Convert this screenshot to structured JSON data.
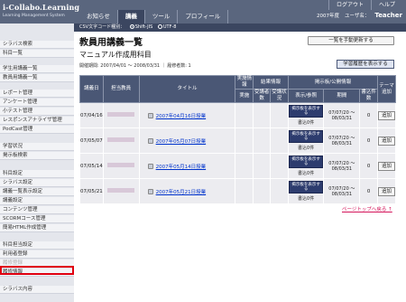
{
  "logo": {
    "title": "i-Collabo.Learning",
    "subtitle": "Learning Management System"
  },
  "header": {
    "links": [
      "ログアウト",
      "ヘルプ"
    ],
    "tabs": [
      "お知らせ",
      "講義",
      "ツール",
      "プロフィール"
    ],
    "active_tab": "講義",
    "year": "2007年度",
    "user_label": "ユーザ名：",
    "role": "Teacher"
  },
  "charset": {
    "label": "CSV文字コード種別",
    "options": [
      "Shift-JIS",
      "UTF-8"
    ],
    "selected": "Shift-JIS"
  },
  "sidebar": {
    "items": [
      {
        "label": "シラバス検索",
        "gray": false
      },
      {
        "label": "科目一覧",
        "gray": false
      },
      {
        "label": "学生用講義一覧",
        "gray": false
      },
      {
        "label": "教員用講義一覧",
        "gray": false
      },
      {
        "label": "レポート管理",
        "gray": false
      },
      {
        "label": "アンケート管理",
        "gray": false
      },
      {
        "label": "小テスト管理",
        "gray": false
      },
      {
        "label": "レスポンスアナライザ管理",
        "gray": false
      },
      {
        "label": "PodCast管理",
        "gray": false
      },
      {
        "label": "学習状況",
        "gray": false
      },
      {
        "label": "掲示板検索",
        "gray": false
      },
      {
        "label": "科目設定",
        "gray": false
      },
      {
        "label": "シラバス設定",
        "gray": false
      },
      {
        "label": "講義一覧表示設定",
        "gray": false
      },
      {
        "label": "講義設定",
        "gray": false
      },
      {
        "label": "コンテンツ管理",
        "gray": false
      },
      {
        "label": "SCORMコース管理",
        "gray": false
      },
      {
        "label": "簡易HTML作成管理",
        "gray": false
      },
      {
        "label": "科目担当設定",
        "gray": false
      },
      {
        "label": "利用者登録",
        "gray": false
      },
      {
        "label": "履修登録",
        "gray": true
      },
      {
        "label": "履修情報",
        "gray": false
      },
      {
        "label": "シラバス内容",
        "gray": false
      }
    ]
  },
  "main": {
    "title": "教員用講義一覧",
    "auto_button": "一覧を手動更新する",
    "course": "マニュアル作成用科目",
    "period": "開催期間: 2007/04/01 ～ 2008/03/31 ｜ 履修者数: 1",
    "history_button": "学習履歴を表示する",
    "columns": {
      "date": "講義日",
      "teacher": "担当教員",
      "title": "タイトル",
      "impl": "実施情報",
      "impl_done": "実施",
      "result": "結果情報",
      "result_period": "期間",
      "result_count": "受講者数",
      "result_status": "受講状況",
      "board": "掲示板/公開情報",
      "board_view": "表示/参照",
      "board_period": "期間",
      "board_count": "書込件数",
      "theme": "テーマ追加"
    },
    "rows": [
      {
        "date": "07/04/16",
        "title": "2007年04月16日授業",
        "pub": "掲示板を表示する",
        "writes": "書込0件",
        "period": "07/07/20 ～ 08/03/31",
        "count": "0",
        "add": "追加"
      },
      {
        "date": "07/05/07",
        "title": "2007年05月07日授業",
        "pub": "掲示板を表示する",
        "writes": "書込0件",
        "period": "07/07/20 ～ 08/03/31",
        "count": "0",
        "add": "追加"
      },
      {
        "date": "07/05/14",
        "title": "2007年05月14日授業",
        "pub": "掲示板を表示する",
        "writes": "書込0件",
        "period": "07/07/20 ～ 08/03/31",
        "count": "0",
        "add": "追加"
      },
      {
        "date": "07/05/21",
        "title": "2007年05月21日授業",
        "pub": "掲示板を表示する",
        "writes": "書込0件",
        "period": "07/07/20 ～ 08/03/31",
        "count": "0",
        "add": "追加"
      }
    ],
    "page_top": "ページトップへ戻る ↑"
  }
}
